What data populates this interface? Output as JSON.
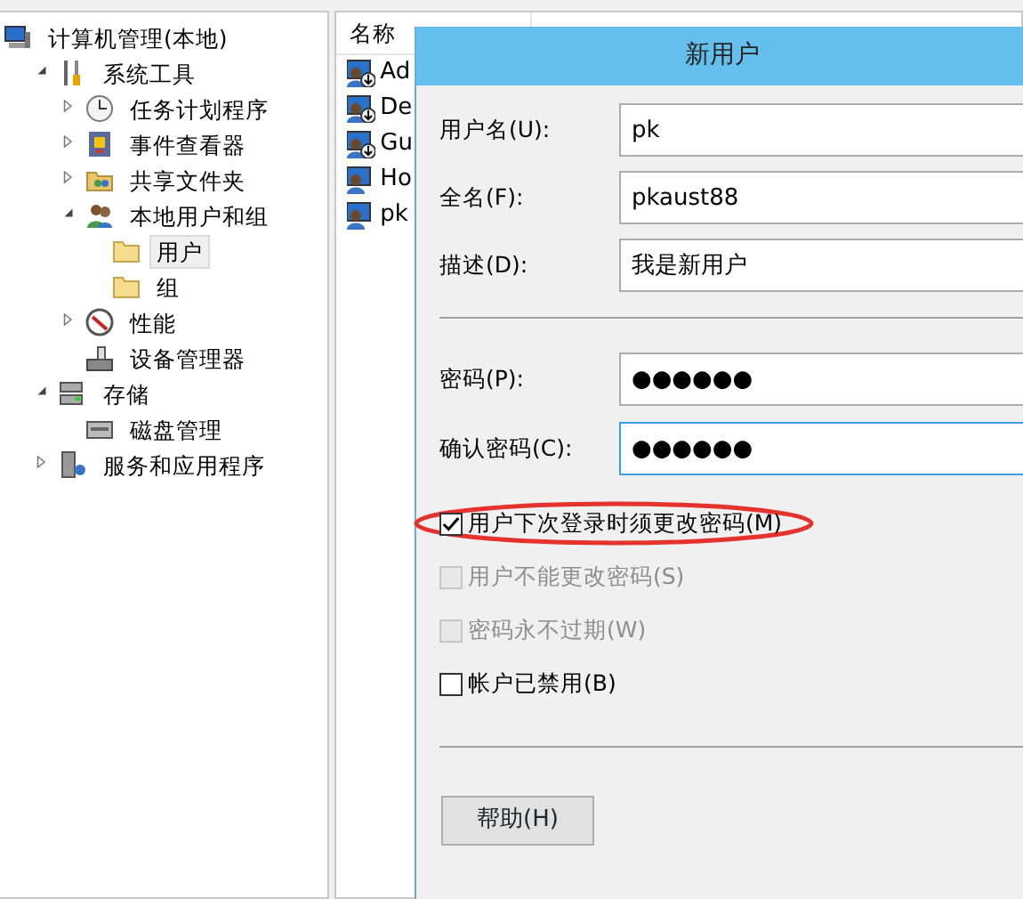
{
  "tree": [
    {
      "label": "计算机管理(本地)",
      "kind": "computer",
      "selected": false,
      "children": [
        {
          "label": "系统工具",
          "kind": "tools",
          "expanded": true,
          "selected": false,
          "children": [
            {
              "label": "任务计划程序",
              "kind": "clock",
              "expanded": false,
              "selected": false
            },
            {
              "label": "事件查看器",
              "kind": "log",
              "expanded": false,
              "selected": false
            },
            {
              "label": "共享文件夹",
              "kind": "share",
              "expanded": false,
              "selected": false
            },
            {
              "label": "本地用户和组",
              "kind": "users",
              "expanded": true,
              "selected": false,
              "children": [
                {
                  "label": "用户",
                  "kind": "folder",
                  "selected": true
                },
                {
                  "label": "组",
                  "kind": "folder",
                  "selected": false
                }
              ]
            },
            {
              "label": "性能",
              "kind": "gauge",
              "expanded": false,
              "selected": false
            },
            {
              "label": "设备管理器",
              "kind": "device",
              "selected": false
            }
          ]
        },
        {
          "label": "存储",
          "kind": "storage",
          "expanded": true,
          "selected": false,
          "children": [
            {
              "label": "磁盘管理",
              "kind": "disk",
              "selected": false
            }
          ]
        },
        {
          "label": "服务和应用程序",
          "kind": "services",
          "expanded": false,
          "selected": false
        }
      ]
    }
  ],
  "list": {
    "columns": [
      "名称"
    ],
    "rows": [
      {
        "name": "Ad",
        "disabled": true
      },
      {
        "name": "De",
        "disabled": true
      },
      {
        "name": "Gu",
        "disabled": true
      },
      {
        "name": "Ho",
        "disabled": false
      },
      {
        "name": "pk",
        "disabled": false
      }
    ]
  },
  "dialog": {
    "title": "新用户",
    "fields": [
      {
        "label": "用户名(U):",
        "value": "pk",
        "focused": false
      },
      {
        "label": "全名(F):",
        "value": "pkaust88",
        "focused": false
      },
      {
        "label": "描述(D):",
        "value": "我是新用户",
        "focused": false
      }
    ],
    "password_fields": [
      {
        "label": "密码(P):",
        "value": "●●●●●●",
        "focused": false
      },
      {
        "label": "确认密码(C):",
        "value": "●●●●●●",
        "focused": true
      }
    ],
    "checkboxes": [
      {
        "label": "用户下次登录时须更改密码(M)",
        "checked": true,
        "disabled": false,
        "highlighted": true
      },
      {
        "label": "用户不能更改密码(S)",
        "checked": false,
        "disabled": true,
        "highlighted": false
      },
      {
        "label": "密码永不过期(W)",
        "checked": false,
        "disabled": true,
        "highlighted": false
      },
      {
        "label": "帐户已禁用(B)",
        "checked": false,
        "disabled": false,
        "highlighted": false
      }
    ],
    "buttons": [
      "帮助(H)"
    ]
  }
}
